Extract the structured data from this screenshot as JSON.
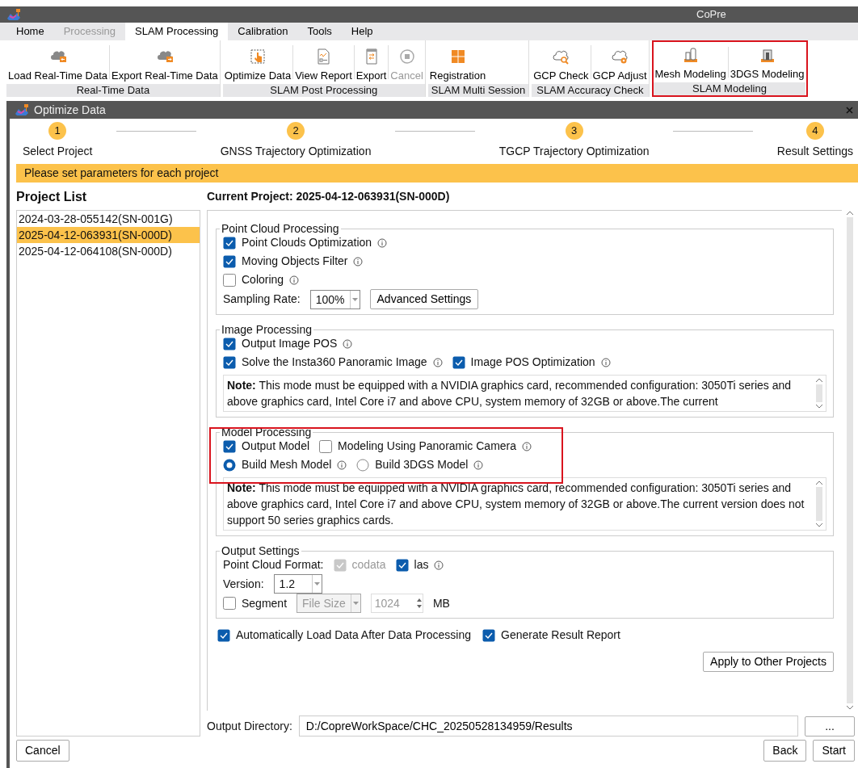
{
  "app": {
    "title": "CoPre"
  },
  "menu": [
    {
      "label": "Home",
      "selected": false,
      "disabled": false
    },
    {
      "label": "Processing",
      "selected": false,
      "disabled": true
    },
    {
      "label": "SLAM Processing",
      "selected": true,
      "disabled": false
    },
    {
      "label": "Calibration",
      "selected": false,
      "disabled": false
    },
    {
      "label": "Tools",
      "selected": false,
      "disabled": false
    },
    {
      "label": "Help",
      "selected": false,
      "disabled": false
    }
  ],
  "ribbon_groups": [
    {
      "label": "Real-Time Data",
      "buttons": [
        {
          "label": "Load Real-Time Data",
          "kind": "load",
          "disabled": false
        },
        {
          "label": "Export Real-Time Data",
          "kind": "transfer",
          "disabled": false
        }
      ]
    },
    {
      "label": "SLAM Post Processing",
      "buttons": [
        {
          "label": "Optimize Data",
          "kind": "optimize",
          "disabled": false
        },
        {
          "label": "View Report",
          "kind": "report",
          "disabled": false
        },
        {
          "label": "Export",
          "kind": "export",
          "disabled": false
        },
        {
          "label": "Cancel",
          "kind": "cancel",
          "disabled": true
        }
      ]
    },
    {
      "label": "SLAM Multi Session",
      "buttons": [
        {
          "label": "Registration",
          "kind": "registration",
          "disabled": false
        }
      ]
    },
    {
      "label": "SLAM Accuracy Check",
      "buttons": [
        {
          "label": "GCP Check",
          "kind": "check",
          "disabled": false
        },
        {
          "label": "GCP Adjust",
          "kind": "adjust",
          "disabled": false
        }
      ]
    },
    {
      "label": "SLAM Modeling",
      "highlighted": true,
      "buttons": [
        {
          "label": "Mesh Modeling",
          "kind": "mesh",
          "disabled": false
        },
        {
          "label": "3DGS Modeling",
          "kind": "gaussian",
          "disabled": false
        }
      ]
    }
  ],
  "dialog": {
    "title": "Optimize Data",
    "steps": [
      {
        "number": "1",
        "label": "Select Project"
      },
      {
        "number": "2",
        "label": "GNSS Trajectory Optimization"
      },
      {
        "number": "3",
        "label": "TGCP Trajectory Optimization"
      },
      {
        "number": "4",
        "label": "Result Settings"
      }
    ],
    "banner": "Please set parameters for each project",
    "project_list": {
      "title": "Project List",
      "items": [
        {
          "label": "2024-03-28-055142(SN-001G)",
          "selected": false
        },
        {
          "label": "2025-04-12-063931(SN-000D)",
          "selected": true
        },
        {
          "label": "2025-04-12-064108(SN-000D)",
          "selected": false
        }
      ]
    },
    "current_project": "Current Project: 2025-04-12-063931(SN-000D)",
    "sections": [
      {
        "title": "Point Cloud Processing",
        "rows": [
          [
            {
              "kind": "checkbox",
              "label": "Point Clouds Optimization",
              "checked": true,
              "info": true
            }
          ],
          [
            {
              "kind": "checkbox",
              "label": "Moving Objects Filter",
              "checked": true,
              "info": true
            }
          ],
          [
            {
              "kind": "checkbox",
              "label": "Coloring",
              "checked": false,
              "info": true
            }
          ],
          [
            {
              "kind": "label",
              "label": "Sampling Rate:"
            },
            {
              "kind": "combo",
              "value": "100%"
            },
            {
              "kind": "button",
              "label": "Advanced Settings"
            }
          ]
        ]
      },
      {
        "title": "Image Processing",
        "rows": [
          [
            {
              "kind": "checkbox",
              "label": "Output Image POS",
              "checked": true,
              "info": true
            }
          ],
          [
            {
              "kind": "checkbox",
              "label": "Solve the Insta360 Panoramic Image",
              "checked": true,
              "info": true
            },
            {
              "kind": "checkbox",
              "label": "Image POS Optimization",
              "checked": true,
              "info": true
            }
          ],
          [
            {
              "kind": "note",
              "text": "**Note:** This mode must be equipped with a NVIDIA graphics card, recommended configuration: 3050Ti series and above graphics card, Intel Core i7 and above CPU, system memory of 32GB or above.The current"
            }
          ]
        ]
      },
      {
        "title": "Model Processing",
        "highlighted": true,
        "rows": [
          [
            {
              "kind": "checkbox",
              "label": "Output Model",
              "checked": true
            },
            {
              "kind": "checkbox",
              "label": "Modeling Using Panoramic Camera",
              "checked": false,
              "info": true
            }
          ],
          [
            {
              "kind": "radio",
              "label": "Build Mesh Model",
              "selected": true,
              "info": true
            },
            {
              "kind": "radio",
              "label": "Build 3DGS Model",
              "selected": false,
              "info": true
            }
          ],
          [
            {
              "kind": "note",
              "text": "**Note:** This mode must be equipped with a NVIDIA graphics card, recommended configuration: 3050Ti series and above graphics card, Intel Core i7 and above CPU, system memory of 32GB or above.The current version does not support 50 series graphics cards."
            }
          ]
        ]
      },
      {
        "title": "Output Settings",
        "rows": [
          [
            {
              "kind": "label",
              "label": "Point Cloud Format:"
            },
            {
              "kind": "checkbox",
              "label": "codata",
              "checked": true,
              "disabled": true
            },
            {
              "kind": "checkbox",
              "label": "las",
              "checked": true,
              "info": true
            }
          ],
          [
            {
              "kind": "label",
              "label": "Version:"
            },
            {
              "kind": "combo",
              "value": "1.2"
            }
          ],
          [
            {
              "kind": "checkbox",
              "label": "Segment",
              "checked": false
            },
            {
              "kind": "combo",
              "value": "File Size",
              "disabled": true
            },
            {
              "kind": "spin",
              "value": "1024",
              "disabled": true
            },
            {
              "kind": "label",
              "label": "MB"
            }
          ]
        ]
      }
    ],
    "options": [
      {
        "label": "Automatically Load Data After Data Processing",
        "checked": true
      },
      {
        "label": "Generate Result Report",
        "checked": true
      }
    ],
    "apply_button": "Apply to Other Projects",
    "output_directory": {
      "label": "Output Directory:",
      "value": "D:/CopreWorkSpace/CHC_20250528134959/Results",
      "browse": "..."
    },
    "footer": {
      "cancel": "Cancel",
      "back": "Back",
      "start": "Start"
    }
  }
}
